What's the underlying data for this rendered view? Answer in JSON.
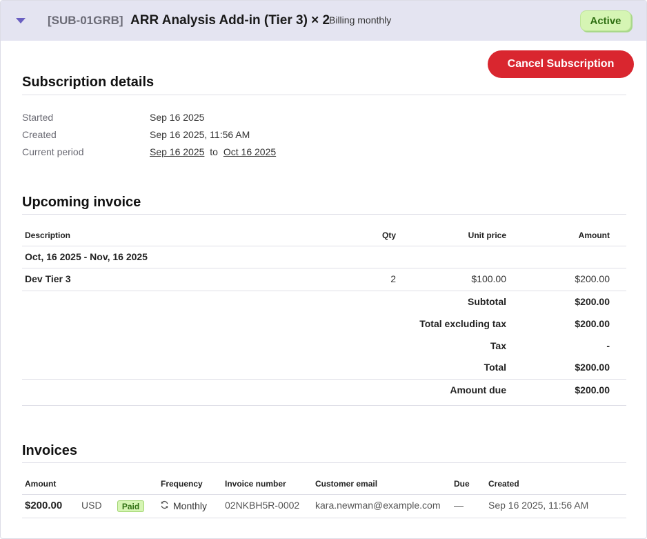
{
  "header": {
    "sub_id": "[SUB-01GRB]",
    "title": "ARR Analysis Add-in (Tier 3) × 2",
    "billing": "Billing monthly",
    "status": "Active",
    "toggle_icon": "caret-down-icon"
  },
  "actions": {
    "cancel_label": "Cancel Subscription"
  },
  "details": {
    "title": "Subscription details",
    "started_label": "Started",
    "started_value": "Sep 16 2025",
    "created_label": "Created",
    "created_value": "Sep 16 2025, 11:56 AM",
    "period_label": "Current period",
    "period_start": "Sep 16 2025",
    "period_to": "to",
    "period_end": "Oct 16 2025"
  },
  "upcoming": {
    "title": "Upcoming invoice",
    "columns": {
      "description": "Description",
      "qty": "Qty",
      "unit_price": "Unit price",
      "amount": "Amount"
    },
    "period": "Oct, 16 2025 - Nov, 16 2025",
    "line": {
      "description": "Dev Tier 3",
      "qty": "2",
      "unit_price": "$100.00",
      "amount": "$200.00"
    },
    "summary": [
      {
        "label": "Subtotal",
        "value": "$200.00"
      },
      {
        "label": "Total excluding tax",
        "value": "$200.00"
      },
      {
        "label": "Tax",
        "value": "-"
      },
      {
        "label": "Total",
        "value": "$200.00"
      },
      {
        "label": "Amount due",
        "value": "$200.00"
      }
    ]
  },
  "invoices": {
    "title": "Invoices",
    "columns": {
      "amount": "Amount",
      "frequency": "Frequency",
      "number": "Invoice number",
      "email": "Customer email",
      "due": "Due",
      "created": "Created"
    },
    "rows": [
      {
        "amount": "$200.00",
        "currency": "USD",
        "status": "Paid",
        "frequency": "Monthly",
        "number": "02NKBH5R-0002",
        "email": "kara.newman@example.com",
        "due": "—",
        "created": "Sep 16 2025, 11:56 AM"
      }
    ]
  },
  "colors": {
    "header_bg": "#e4e4f1",
    "accent": "#6a5fc1",
    "danger": "#d9262f",
    "success_bg": "#d6f5b4",
    "success_text": "#2f6f12"
  }
}
